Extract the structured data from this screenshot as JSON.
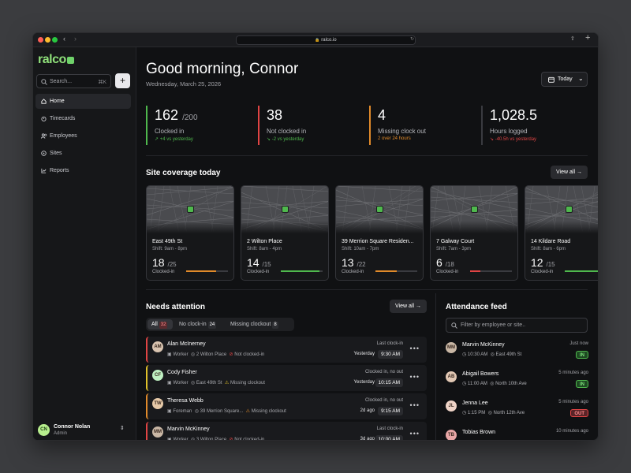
{
  "browser": {
    "url": "ralco.io"
  },
  "sidebar": {
    "logo": "ralco",
    "search_placeholder": "Search...",
    "search_shortcut": "⌘K",
    "add_label": "+",
    "items": [
      {
        "label": "Home",
        "icon": "home-icon"
      },
      {
        "label": "Timecards",
        "icon": "timer-icon"
      },
      {
        "label": "Employees",
        "icon": "users-icon"
      },
      {
        "label": "Sites",
        "icon": "pin-icon"
      },
      {
        "label": "Reports",
        "icon": "chart-icon"
      }
    ],
    "user": {
      "initials": "CN",
      "name": "Connor Nolan",
      "role": "Admin"
    }
  },
  "header": {
    "greeting": "Good morning, Connor",
    "date": "Wednesday, March 25, 2026",
    "today_label": "Today"
  },
  "stats": [
    {
      "value": "162",
      "total": "/200",
      "label": "Clocked in",
      "delta": "↗ +4 vs yesterday",
      "color": "#4fb84d"
    },
    {
      "value": "38",
      "total": "",
      "label": "Not clocked in",
      "delta": "↘ -2 vs yesterday",
      "color": "#e04444"
    },
    {
      "value": "4",
      "total": "",
      "label": "Missing clock out",
      "delta": "2 over 24 hours",
      "color": "#e08a2a"
    },
    {
      "value": "1,028.5",
      "total": "",
      "label": "Hours logged",
      "delta": "↘ -40.5h vs yesterday",
      "color": "#e04444"
    }
  ],
  "coverage": {
    "title": "Site coverage today",
    "view_all": "View all",
    "sites": [
      {
        "name": "East 49th St",
        "shift": "Shift: 9am - 8pm",
        "count": "18",
        "total": "/25",
        "label": "Clocked-in",
        "progress": 0.72,
        "color": "#e08a2a"
      },
      {
        "name": "2 Wilton Place",
        "shift": "Shift: 8am - 4pm",
        "count": "14",
        "total": "/15",
        "label": "Clocked-in",
        "progress": 0.93,
        "color": "#4fb84d"
      },
      {
        "name": "39 Merrion Square Residen...",
        "shift": "Shift: 10am - 7pm",
        "count": "13",
        "total": "/22",
        "label": "Clocked-in",
        "progress": 0.5,
        "color": "#e08a2a"
      },
      {
        "name": "7 Galway Court",
        "shift": "Shift: 7am - 3pm",
        "count": "6",
        "total": "/18",
        "label": "Clocked-in",
        "progress": 0.25,
        "color": "#e04444"
      },
      {
        "name": "14 Kildare Road",
        "shift": "Shift: 8am - 6pm",
        "count": "12",
        "total": "/15",
        "label": "Clocked-in",
        "progress": 0.8,
        "color": "#4fb84d"
      }
    ]
  },
  "attention": {
    "title": "Needs attention",
    "view_all": "View all",
    "tabs": [
      {
        "label": "All",
        "count": "32"
      },
      {
        "label": "No clock-in",
        "count": "24"
      },
      {
        "label": "Missing clockout",
        "count": "8"
      }
    ],
    "rows": [
      {
        "name": "Alan McInerney",
        "role": "Worker",
        "site": "2 Wilton Place",
        "issue": "Not clocked-in",
        "status": "Last clock-in",
        "day": "Yesterday",
        "time": "9:30 AM",
        "color": "#e04444",
        "initials": "AM",
        "avatar_bg": "#d9c4b0"
      },
      {
        "name": "Cody Fisher",
        "role": "Worker",
        "site": "East 49th St",
        "issue": "Missing clockout",
        "status": "Clocked in, no out",
        "day": "Yesterday",
        "time": "10:15 AM",
        "color": "#e0c12a",
        "initials": "CF",
        "avatar_bg": "#bff0c2"
      },
      {
        "name": "Theresa Webb",
        "role": "Foreman",
        "site": "39 Merrion Square...",
        "issue": "Missing clockout",
        "status": "Clocked in, no out",
        "day": "2d ago",
        "time": "9:15 AM",
        "color": "#e08a2a",
        "initials": "TW",
        "avatar_bg": "#e6c9a8"
      },
      {
        "name": "Marvin McKinney",
        "role": "Worker",
        "site": "3 Wilton Place",
        "issue": "Not clocked-in",
        "status": "Last clock-in",
        "day": "3d ago",
        "time": "10:00 AM",
        "color": "#e04444",
        "initials": "MM",
        "avatar_bg": "#c9b7a5"
      }
    ]
  },
  "feed": {
    "title": "Attendance feed",
    "search_placeholder": "Filter by employee or site..",
    "items": [
      {
        "name": "Marvin McKinney",
        "ago": "Just now",
        "time": "10:30 AM",
        "site": "East 49th St",
        "badge": "IN",
        "initials": "MM",
        "avatar_bg": "#c9b7a5"
      },
      {
        "name": "Abigail Bowers",
        "ago": "5 minutes ago",
        "time": "11:00 AM",
        "site": "North 10th Ave",
        "badge": "IN",
        "initials": "AB",
        "avatar_bg": "#e2c8b4"
      },
      {
        "name": "Jenna Lee",
        "ago": "5 minutes ago",
        "time": "1:15 PM",
        "site": "North 12th Ave",
        "badge": "OUT",
        "initials": "JL",
        "avatar_bg": "#f0d5c8"
      },
      {
        "name": "Tobias Brown",
        "ago": "10 minutes ago",
        "time": "",
        "site": "",
        "badge": "",
        "initials": "TB",
        "avatar_bg": "#e8a6a6"
      }
    ]
  }
}
